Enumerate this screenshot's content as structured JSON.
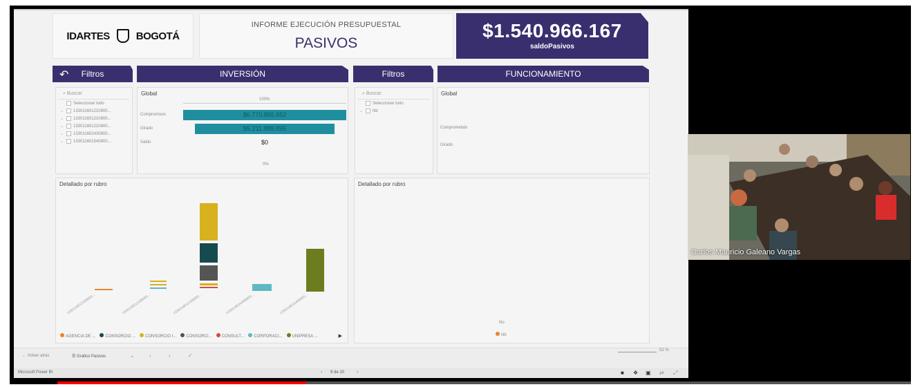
{
  "header": {
    "logos": {
      "logo_1": "IDARTES",
      "logo_2": "BOGOTÁ"
    },
    "subtitle": "INFORME EJECUCIÓN PRESUPUESTAL",
    "title": "PASIVOS",
    "kpi_value": "$1.540.966.167",
    "kpi_label": "saldoPasivos"
  },
  "tabs": {
    "filtros_1": "Filtros",
    "inversion": "INVERSIÓN",
    "filtros_2": "Filtros",
    "funcionamiento": "FUNCIONAMIENTO"
  },
  "slicer_1": {
    "search_placeholder": "Buscar",
    "select_all": "Seleccionar todo",
    "items": [
      "133011601210800...",
      "133011601210800...",
      "133011601210800...",
      "133011602430800...",
      "133011601540800..."
    ]
  },
  "slicer_2": {
    "search_placeholder": "Buscar",
    "select_all": "Seleccionar todo",
    "items": [
      "Nb"
    ]
  },
  "gauge_1": {
    "title": "Global",
    "top_label": "100%",
    "rows": [
      {
        "label": "Compromisos",
        "value": "$6.770.855.652",
        "fraction": 1.0,
        "color": "#1f8fa0"
      },
      {
        "label": "Girado",
        "value": "$5.211.888.895",
        "fraction": 0.86,
        "color": "#1f8fa0"
      },
      {
        "label": "Saldo",
        "value": "$0",
        "fraction": 0,
        "color": "#1f8fa0"
      }
    ],
    "bottom_label": "0%"
  },
  "gauge_2": {
    "title": "Global",
    "rows": [
      {
        "label": "Comprometido"
      },
      {
        "label": "Girado"
      }
    ]
  },
  "detail_1": {
    "title": "Detallado por rubro",
    "legend": [
      {
        "label": "AGENCIA DE ...",
        "color": "#e8852f"
      },
      {
        "label": "CONSORCIO ...",
        "color": "#174a4f"
      },
      {
        "label": "CONSORCIO I...",
        "color": "#d7b11e"
      },
      {
        "label": "CONSORCI...",
        "color": "#555555"
      },
      {
        "label": "CONSULT...",
        "color": "#d64b3b"
      },
      {
        "label": "CORPORACI...",
        "color": "#5fb8c4"
      },
      {
        "label": "UNIPRESA ...",
        "color": "#6b7d1f"
      }
    ]
  },
  "detail_2": {
    "title": "Detallado por rubro",
    "no_label": "No",
    "legend_label": "Nb"
  },
  "pbi_bottom": {
    "back_label": "Volver atrás",
    "page_label": "Grafico Pasivos",
    "zoom": "52 %",
    "page_counter": "9 de 10",
    "app_name": "Microsoft Power BI"
  },
  "video": {
    "participant_name": "Carlos Mauricio Galeano Vargas"
  },
  "colors": {
    "brand": "#3a2f6e",
    "accent": "#1f8fa0",
    "progress": "#ff0000"
  }
}
